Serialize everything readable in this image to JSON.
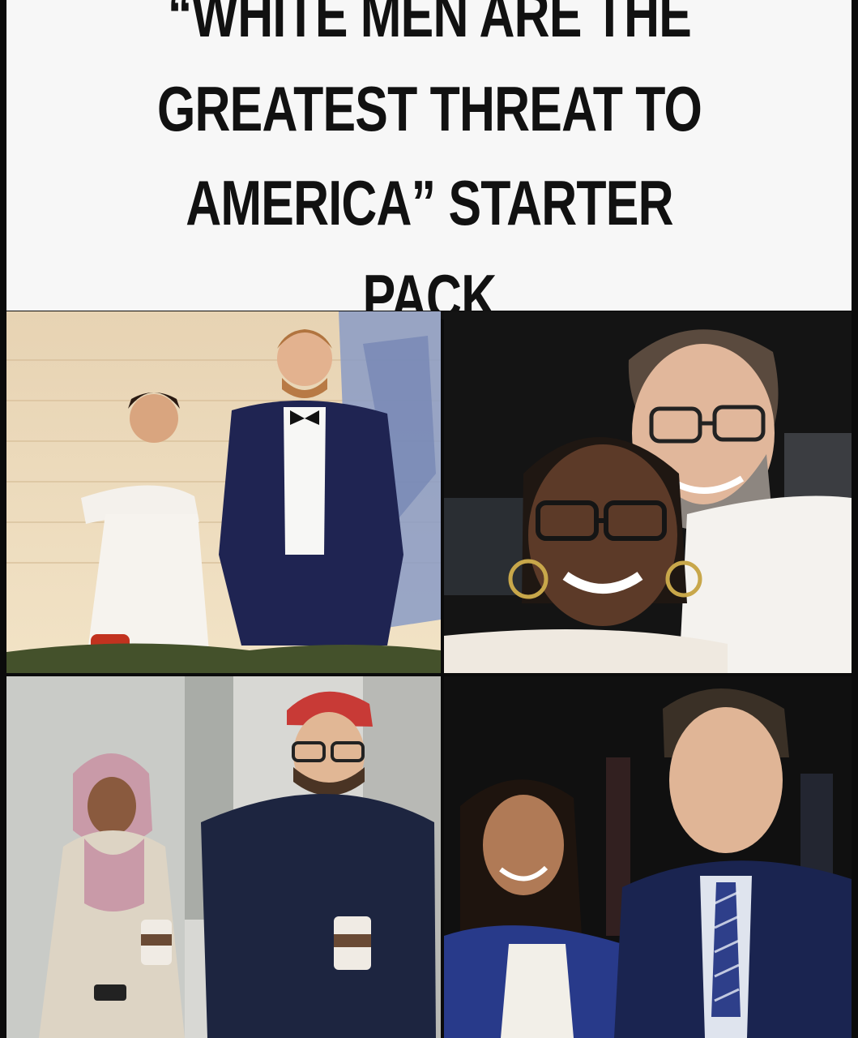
{
  "meme": {
    "title": "“WHITE MEN ARE THE GREATEST THREAT TO AMERICA” STARTER PACK"
  },
  "panels": [
    {
      "subject": "woman-in-white-dress-with-man-in-tuxedo"
    },
    {
      "subject": "woman-with-glasses-and-bearded-man-selfie"
    },
    {
      "subject": "woman-in-hijab-with-man-in-hoodie"
    },
    {
      "subject": "woman-in-blue-blazer-with-man-in-suit"
    }
  ],
  "colors": {
    "header_bg": "#f7f7f7",
    "title_text": "#111111",
    "page_bg": "#0b0b0b"
  }
}
